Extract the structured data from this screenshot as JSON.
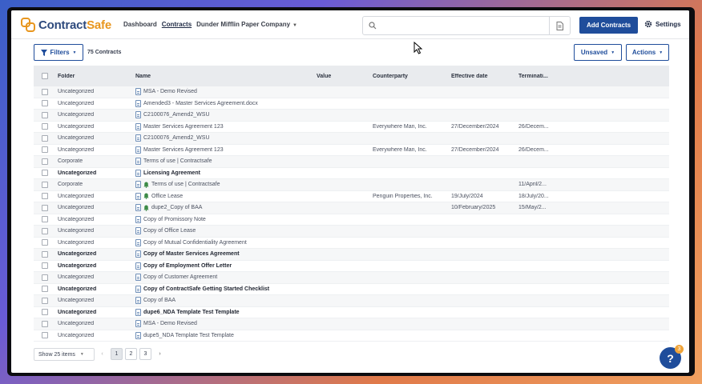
{
  "header": {
    "logo_contract": "Contract",
    "logo_safe": "Safe",
    "nav": {
      "dashboard": "Dashboard",
      "contracts": "Contracts",
      "company": "Dunder Mifflin Paper Company"
    },
    "search_placeholder": "",
    "add_contracts": "Add Contracts",
    "settings": "Settings"
  },
  "toolbar": {
    "filters": "Filters",
    "count": "75 Contracts",
    "unsaved": "Unsaved",
    "actions": "Actions"
  },
  "table": {
    "columns": {
      "folder": "Folder",
      "name": "Name",
      "value": "Value",
      "counterparty": "Counterparty",
      "effective": "Effective date",
      "termination": "Terminati..."
    },
    "rows": [
      {
        "folder": "Uncategorized",
        "name": "MSA - Demo Revised",
        "cp": "",
        "eff": "",
        "term": "",
        "bold": false,
        "bell": false
      },
      {
        "folder": "Uncategorized",
        "name": "Amended3 - Master Services Agreement.docx",
        "cp": "",
        "eff": "",
        "term": "",
        "bold": false,
        "bell": false
      },
      {
        "folder": "Uncategorized",
        "name": "C2100076_Amend2_WSU",
        "cp": "",
        "eff": "",
        "term": "",
        "bold": false,
        "bell": false
      },
      {
        "folder": "Uncategorized",
        "name": "Master Services Agreement 123",
        "cp": "Everywhere Man, Inc.",
        "eff": "27/December/2024",
        "term": "26/Decem...",
        "bold": false,
        "bell": false
      },
      {
        "folder": "Uncategorized",
        "name": "C2100076_Amend2_WSU",
        "cp": "",
        "eff": "",
        "term": "",
        "bold": false,
        "bell": false
      },
      {
        "folder": "Uncategorized",
        "name": "Master Services Agreement 123",
        "cp": "Everywhere Man, Inc.",
        "eff": "27/December/2024",
        "term": "26/Decem...",
        "bold": false,
        "bell": false
      },
      {
        "folder": "Corporate",
        "name": "Terms of use | Contractsafe",
        "cp": "",
        "eff": "",
        "term": "",
        "bold": false,
        "bell": false
      },
      {
        "folder": "Uncategorized",
        "name": "Licensing Agreement",
        "cp": "",
        "eff": "",
        "term": "",
        "bold": true,
        "bell": false
      },
      {
        "folder": "Corporate",
        "name": "Terms of use | Contractsafe",
        "cp": "",
        "eff": "",
        "term": "11/April/2...",
        "bold": false,
        "bell": true
      },
      {
        "folder": "Uncategorized",
        "name": "Office Lease",
        "cp": "Penguin Properties, Inc.",
        "eff": "19/July/2024",
        "term": "18/July/20...",
        "bold": false,
        "bell": true
      },
      {
        "folder": "Uncategorized",
        "name": "dupe2_Copy of BAA",
        "cp": "",
        "eff": "10/February/2025",
        "term": "15/May/2...",
        "bold": false,
        "bell": true
      },
      {
        "folder": "Uncategorized",
        "name": "Copy of Promissory Note",
        "cp": "",
        "eff": "",
        "term": "",
        "bold": false,
        "bell": false
      },
      {
        "folder": "Uncategorized",
        "name": "Copy of Office Lease",
        "cp": "",
        "eff": "",
        "term": "",
        "bold": false,
        "bell": false
      },
      {
        "folder": "Uncategorized",
        "name": "Copy of Mutual Confidentiality Agreement",
        "cp": "",
        "eff": "",
        "term": "",
        "bold": false,
        "bell": false
      },
      {
        "folder": "Uncategorized",
        "name": "Copy of Master Services Agreement",
        "cp": "",
        "eff": "",
        "term": "",
        "bold": true,
        "bell": false
      },
      {
        "folder": "Uncategorized",
        "name": "Copy of Employment Offer Letter",
        "cp": "",
        "eff": "",
        "term": "",
        "bold": true,
        "bell": false
      },
      {
        "folder": "Uncategorized",
        "name": "Copy of Customer Agreement",
        "cp": "",
        "eff": "",
        "term": "",
        "bold": false,
        "bell": false
      },
      {
        "folder": "Uncategorized",
        "name": "Copy of ContractSafe Getting Started Checklist",
        "cp": "",
        "eff": "",
        "term": "",
        "bold": true,
        "bell": false
      },
      {
        "folder": "Uncategorized",
        "name": "Copy of BAA",
        "cp": "",
        "eff": "",
        "term": "",
        "bold": false,
        "bell": false
      },
      {
        "folder": "Uncategorized",
        "name": "dupe6_NDA Template Test Template",
        "cp": "",
        "eff": "",
        "term": "",
        "bold": true,
        "bell": false
      },
      {
        "folder": "Uncategorized",
        "name": "MSA - Demo Revised",
        "cp": "",
        "eff": "",
        "term": "",
        "bold": false,
        "bell": false
      },
      {
        "folder": "Uncategorized",
        "name": "dupe5_NDA Template Test Template",
        "cp": "",
        "eff": "",
        "term": "",
        "bold": false,
        "bell": false
      }
    ]
  },
  "pagination": {
    "show": "Show 25 items",
    "prev": "‹",
    "pages": [
      "1",
      "2",
      "3"
    ],
    "next": "›"
  },
  "help": {
    "label": "?",
    "badge": "3"
  },
  "colors": {
    "primary": "#1f4d9b",
    "brand_orange": "#e8961e",
    "brand_navy": "#2e4a7d"
  }
}
